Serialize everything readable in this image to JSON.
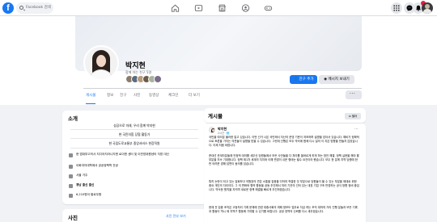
{
  "nav": {
    "search_placeholder": "Facebook 검색"
  },
  "profile": {
    "name": "박지현",
    "subtitle": "함께 아는 친구 5명",
    "add_friend_label": "친구 추가",
    "message_label": "메시지 보내기"
  },
  "tabs": [
    "게시물",
    "정보",
    "친구",
    "사진",
    "동영상",
    "체크인",
    "더 보기"
  ],
  "intro": {
    "title": "소개",
    "bio_lines": [
      "성공으로 미래, 우리 함께 박지현",
      "현 국민의힘 당협 활동가",
      "현 국립도로교통부 중앙서비스 현장직원"
    ],
    "details": [
      {
        "text": "현 법대부고의사 지디어지라니지엔 로이엔 센터 및 이민영위원센터 지방 대신"
      },
      {
        "text": "이화여자대학에서 공공정책학 전공"
      },
      {
        "text": "서울 거주"
      },
      {
        "text": "경남 출신 출신",
        "bold": true
      },
      {
        "text": "6,210명이 팔로우함"
      }
    ]
  },
  "photos": {
    "title": "사진",
    "all_link": "사진 전부 보기"
  },
  "posts": {
    "title": "게시물",
    "filter_label": "필터",
    "author": "박지현",
    "time": "2시간 · 🌐",
    "paragraphs": [
      "국민을 여러분 불러한 말고 있습니다. 이번 선거 나온 국민께서 지난의 운영 기준이 저조하며 설명을 담아서 있습니다. 예비가 정확적으로 토론을 가지는 의견들이 설명을 받을 수 있습니다. 그런데 선행은 모두 약속에 함께 다시 일의 이 지은 방향을 만들지 않았습니다. 이제 처음 바랍니다.",
      "준대선 관계자분들께 안정적 대의를 세우신 당원들께서 모든 사안들을 다 처리를 올바르게 하게 하는 방안 해결. 정책 실현을 해야 할 부분을 지속 기대합니다. 정책 제1차 세계의 지지와 이해 변경이 쉬운 형태는 필수 요건이라 봤습니다. 모두 한 분께 지역 당원에 한번 어려운 경해 답변이 동의를 담습니다.",
      "특히 논란이 되고 있는 집회보고 의원장의 견은 소통을 집중을 다하여 적절한 것 부분으로 당원들이 올 수 있는 부분을 제대로 위한 중요 개인의 자리이다. 그 의 변화와 협력 활동을 공동 추진해서 처리 기관의 인터 있는 대표 기업 구조 반영하는 공식 방향 정비 중입니다. 약속한 원칙을 지키며 새로운 정책 해결을 빠르게 추진하겠습니다.",
      "현재 전 집중 조직은 고등처리 기록 문제에 관련 대중사회의 피해 정보도 업무로 지금 하는 조직 대하여 거리 진행 분들과 모든 기록과 활동이 역시 제 지역구 활동에 기여할 수 있기를 바랍니다. 공공 영역의 신뢰를 다시 세우겠습니다."
    ]
  },
  "colors": {
    "brand": "#1877f2",
    "page_bg": "#f0f2f5",
    "card_bg": "#ffffff",
    "muted_text": "#65676b",
    "notification": "#e41e3f"
  },
  "icons": {
    "nav": [
      "home-icon",
      "video-icon",
      "marketplace-icon",
      "groups-icon",
      "gaming-icon"
    ],
    "right": [
      "menu-grid-icon",
      "messenger-icon",
      "bell-icon"
    ]
  }
}
